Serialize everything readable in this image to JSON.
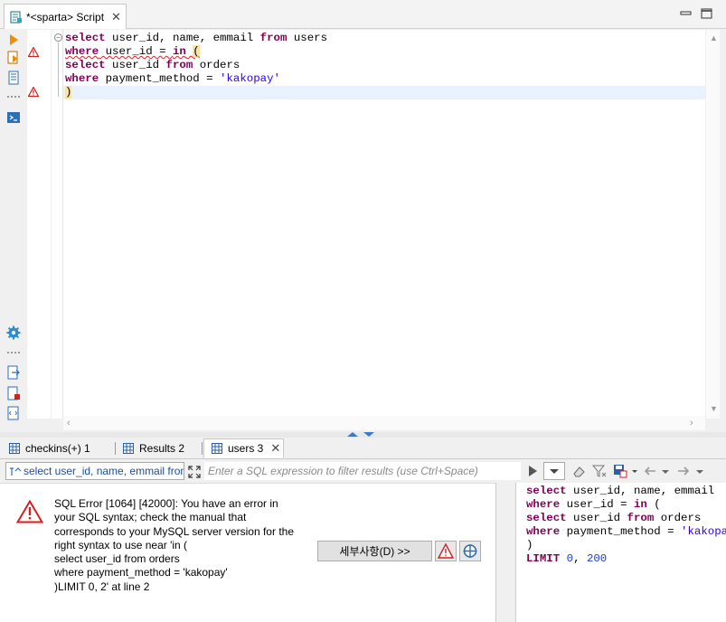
{
  "editor_tab": {
    "label": "*<sparta> Script",
    "close": "✕"
  },
  "editor": {
    "lines": [
      [
        {
          "t": "select",
          "c": "kw"
        },
        {
          "t": " user_id, name, emmail "
        },
        {
          "t": "from",
          "c": "kw"
        },
        {
          "t": " users"
        }
      ],
      [
        {
          "t": "where",
          "c": "kw sq"
        },
        {
          "t": " user_id = ",
          "c": "sq"
        },
        {
          "t": "in",
          "c": "kw sq"
        },
        {
          "t": " ",
          "c": "sq"
        },
        {
          "t": "(",
          "c": "ph sq"
        }
      ],
      [
        {
          "t": "select",
          "c": "kw"
        },
        {
          "t": " user_id "
        },
        {
          "t": "from",
          "c": "kw"
        },
        {
          "t": " orders"
        }
      ],
      [
        {
          "t": "where",
          "c": "kw"
        },
        {
          "t": " payment_method = "
        },
        {
          "t": "'kakopay'",
          "c": "str"
        }
      ],
      [
        {
          "t": ")",
          "c": "ph"
        }
      ]
    ]
  },
  "results_tabs": [
    {
      "label": "checkins(+) 1"
    },
    {
      "label": "Results 2"
    },
    {
      "label": "users 3",
      "close": "✕"
    }
  ],
  "filter": {
    "query_text": "select user_id, name, emmail from users",
    "placeholder": "Enter a SQL expression to filter results (use Ctrl+Space)"
  },
  "error": {
    "message": "SQL Error [1064] [42000]: You have an error in\nyour SQL syntax; check the manual that\ncorresponds to your MySQL server version for the\nright syntax to use near 'in (\nselect user_id from orders\nwhere payment_method = 'kakopay'\n)LIMIT 0, 2' at line 2",
    "details_button": "세부사항(D) >>"
  },
  "query_panel": {
    "lines": [
      [
        {
          "t": "select",
          "c": "kw"
        },
        {
          "t": " user_id, name, emmail"
        }
      ],
      [
        {
          "t": "where",
          "c": "kw"
        },
        {
          "t": " user_id = "
        },
        {
          "t": "in",
          "c": "kw"
        },
        {
          "t": " ("
        }
      ],
      [
        {
          "t": "select",
          "c": "kw"
        },
        {
          "t": " user_id "
        },
        {
          "t": "from",
          "c": "kw"
        },
        {
          "t": " orders"
        }
      ],
      [
        {
          "t": "where",
          "c": "kw"
        },
        {
          "t": " payment_method = "
        },
        {
          "t": "'kakopay'",
          "c": "str"
        }
      ],
      [
        {
          "t": ")"
        }
      ],
      [
        {
          "t": "LIMIT",
          "c": "kw"
        },
        {
          "t": " "
        },
        {
          "t": "0",
          "c": "num"
        },
        {
          "t": ", "
        },
        {
          "t": "200",
          "c": "num"
        }
      ]
    ]
  },
  "colors": {
    "keyword": "#7f0055",
    "string": "#2a00ff",
    "number": "#1a3ccd",
    "current_line": "#e8f2fe",
    "error_red": "#e02020"
  },
  "icons": [
    "script-icon",
    "run-icon",
    "execute-script-icon",
    "explain-icon",
    "terminal-icon",
    "gear-icon",
    "export-icon",
    "import-icon",
    "format-icon",
    "warning-icon",
    "error-icon",
    "grid-icon",
    "expand-icon",
    "play-icon",
    "eraser-icon",
    "filter-icon",
    "save-icon",
    "arrow-left-icon",
    "arrow-right-icon",
    "crosshair-icon"
  ]
}
